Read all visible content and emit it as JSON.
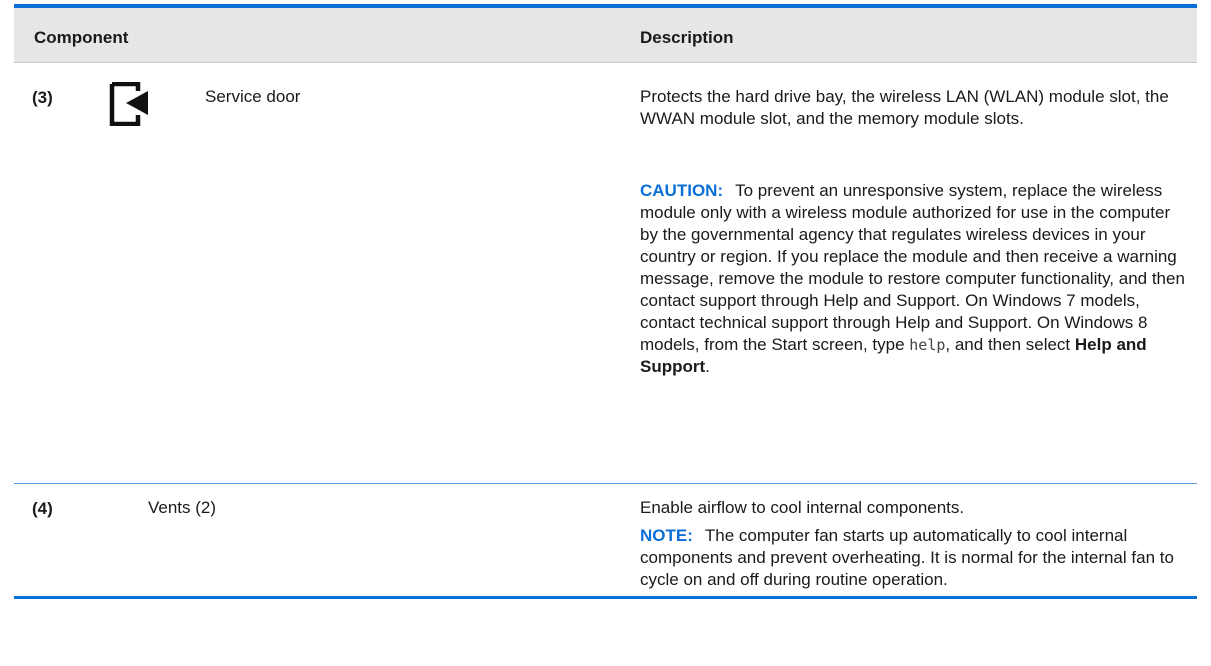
{
  "header": {
    "component_label": "Component",
    "description_label": "Description"
  },
  "rows": [
    {
      "number": "(3)",
      "icon": "service-door-icon",
      "name": "Service door",
      "description": "Protects the hard drive bay, the wireless LAN (WLAN) module slot, the WWAN module slot, and the memory module slots.",
      "caution": {
        "label": "CAUTION:",
        "text_before": "To prevent an unresponsive system, replace the wireless module only with a wireless module authorized for use in the computer by the governmental agency that regulates wireless devices in your country or region. If you replace the module and then receive a warning message, remove the module to restore computer functionality, and then contact support through Help and Support. On Windows 7 models, contact technical support through Help and Support. On Windows 8 models, from the Start screen, type ",
        "code": "help",
        "text_middle": ", and then select ",
        "bold": "Help and Support",
        "text_after": "."
      }
    },
    {
      "number": "(4)",
      "name": "Vents (2)",
      "description": "Enable airflow to cool internal components.",
      "note": {
        "label": "NOTE:",
        "text": "The computer fan starts up automatically to cool internal components and prevent overheating. It is normal for the internal fan to cycle on and off during routine operation."
      }
    }
  ],
  "colors": {
    "accent_blue": "#0a6fd6",
    "header_bg": "#e6e6e6"
  }
}
